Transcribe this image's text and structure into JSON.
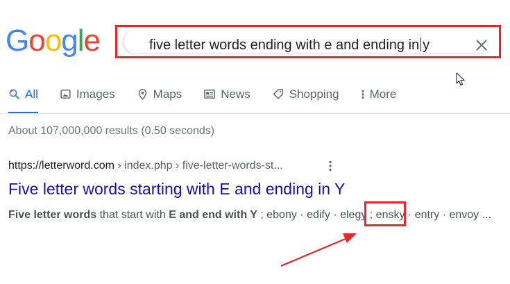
{
  "logo": {
    "letters": [
      "G",
      "o",
      "o",
      "g",
      "l",
      "e"
    ],
    "colors": [
      "#4285f4",
      "#ea4335",
      "#fbbc05",
      "#4285f4",
      "#34a853",
      "#ea4335"
    ]
  },
  "search": {
    "query_before_caret": "five letter words ending with e and ending in",
    "query_after_caret": "y"
  },
  "tabs": [
    {
      "label": "All",
      "icon": "search-icon",
      "active": true
    },
    {
      "label": "Images",
      "icon": "image-icon",
      "active": false
    },
    {
      "label": "Maps",
      "icon": "map-pin-icon",
      "active": false
    },
    {
      "label": "News",
      "icon": "news-icon",
      "active": false
    },
    {
      "label": "Shopping",
      "icon": "tag-icon",
      "active": false
    },
    {
      "label": "More",
      "icon": "more-vert-icon",
      "active": false
    }
  ],
  "result_stats": "About 107,000,000 results (0.50 seconds)",
  "result": {
    "url_base": "https://letterword.com",
    "url_crumbs": " › index.php › five-letter-words-st...",
    "title": "Five letter words starting with E and ending in Y",
    "snippet": {
      "bold1": "Five letter words",
      "text1": " that start with ",
      "bold2": "E and end with Y",
      "text2": " ; ebony · edify · elegy ; ensky · entry · envoy ..."
    }
  },
  "annotation": {
    "highlight_color": "#e8262b"
  }
}
